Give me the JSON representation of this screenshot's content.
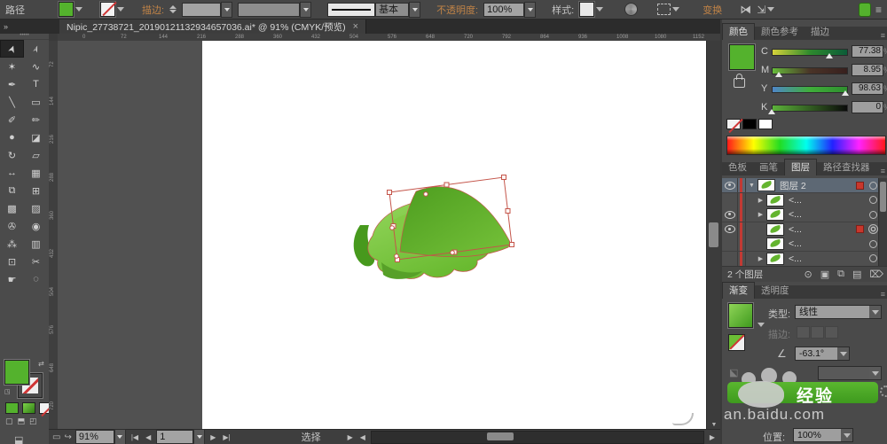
{
  "accent": {
    "green": "#54b22d",
    "selection_red": "#c4554a",
    "orange_label": "#c08347"
  },
  "control_bar": {
    "object_label": "路径",
    "stroke_label": "描边:",
    "stroke_width_value": "",
    "width_profile_value": "",
    "brush_definition_value": "基本",
    "opacity_label": "不透明度:",
    "opacity_value": "100%",
    "style_label": "样式:",
    "transform_label": "变换",
    "menu_icon": "≡"
  },
  "tab_bar": {
    "collapse_icon": "»",
    "title": "Nipic_27738721_20190121132934657036.ai* @ 91% (CMYK/预览)",
    "close_icon": "×"
  },
  "tools": [
    {
      "name": "selection-tool",
      "glyph": "➤",
      "active": true,
      "rot": true
    },
    {
      "name": "direct-selection-tool",
      "glyph": "➢",
      "active": false,
      "rot": true
    },
    {
      "name": "magic-wand-tool",
      "glyph": "✶"
    },
    {
      "name": "lasso-tool",
      "glyph": "∿"
    },
    {
      "name": "pen-tool",
      "glyph": "✒"
    },
    {
      "name": "type-tool",
      "glyph": "T"
    },
    {
      "name": "line-segment-tool",
      "glyph": "╲"
    },
    {
      "name": "rectangle-tool",
      "glyph": "▭"
    },
    {
      "name": "paintbrush-tool",
      "glyph": "✐"
    },
    {
      "name": "pencil-tool",
      "glyph": "✏"
    },
    {
      "name": "blob-brush-tool",
      "glyph": "●"
    },
    {
      "name": "eraser-tool",
      "glyph": "◪"
    },
    {
      "name": "rotate-tool",
      "glyph": "↻"
    },
    {
      "name": "scale-tool",
      "glyph": "▱"
    },
    {
      "name": "width-tool",
      "glyph": "↔"
    },
    {
      "name": "free-transform-tool",
      "glyph": "▦"
    },
    {
      "name": "shape-builder-tool",
      "glyph": "⧉"
    },
    {
      "name": "perspective-grid-tool",
      "glyph": "⊞"
    },
    {
      "name": "mesh-tool",
      "glyph": "▩"
    },
    {
      "name": "gradient-tool",
      "glyph": "▨"
    },
    {
      "name": "eyedropper-tool",
      "glyph": "✇"
    },
    {
      "name": "blend-tool",
      "glyph": "◉"
    },
    {
      "name": "symbol-sprayer-tool",
      "glyph": "⁂"
    },
    {
      "name": "column-graph-tool",
      "glyph": "▥"
    },
    {
      "name": "artboard-tool",
      "glyph": "⊡"
    },
    {
      "name": "slice-tool",
      "glyph": "✂"
    },
    {
      "name": "hand-tool",
      "glyph": "☛"
    },
    {
      "name": "zoom-tool",
      "glyph": "◌"
    }
  ],
  "rulers": {
    "h_labels": [
      "0",
      "72",
      "144",
      "216",
      "288",
      "360",
      "432",
      "504",
      "576",
      "648",
      "720",
      "792",
      "864",
      "936",
      "1008",
      "1080",
      "1152"
    ],
    "v_labels": [
      "72",
      "144",
      "216",
      "288",
      "360",
      "432",
      "504",
      "576",
      "648",
      "720"
    ]
  },
  "status_bar": {
    "zoom_value": "91%",
    "artboard_value": "1",
    "status_text": "选择",
    "nav_first": "|◀",
    "nav_prev": "◀",
    "nav_next": "▶",
    "nav_last": "▶|"
  },
  "color_panel": {
    "tabs": [
      {
        "label": "颜色",
        "active": true
      },
      {
        "label": "颜色参考",
        "active": false
      },
      {
        "label": "描边",
        "active": false
      }
    ],
    "menu_icon": "≡",
    "swatch_color": "#54b22d",
    "channels": [
      {
        "label": "C",
        "value": "77.38",
        "pct": 77,
        "track": "linear-gradient(90deg,#d6d23a,#2e8a2e,#0c5c38)"
      },
      {
        "label": "M",
        "value": "8.95",
        "pct": 9,
        "track": "linear-gradient(90deg,#66bb3a,#4a3428,#38201e)"
      },
      {
        "label": "Y",
        "value": "98.63",
        "pct": 99,
        "track": "linear-gradient(90deg,#4f86c8,#3fae3a,#2f8f2f)"
      },
      {
        "label": "K",
        "value": "0",
        "pct": 0,
        "track": "linear-gradient(90deg,#5cb23a,#0a0a0a)"
      }
    ],
    "pct_sign": "%"
  },
  "panel_tabs": [
    {
      "label": "色板",
      "active": false
    },
    {
      "label": "画笔",
      "active": false
    },
    {
      "label": "图层",
      "active": true
    },
    {
      "label": "路径查找器",
      "active": false
    }
  ],
  "layers": {
    "rows": [
      {
        "name": "图层 2",
        "eye": true,
        "expand": "▼",
        "selected": true,
        "indent": false,
        "target": "normal",
        "red_square": true
      },
      {
        "name": "<...",
        "eye": false,
        "expand": "▶",
        "selected": false,
        "indent": true,
        "target": "normal",
        "red_square": false
      },
      {
        "name": "<...",
        "eye": true,
        "expand": "▶",
        "selected": false,
        "indent": true,
        "target": "normal",
        "red_square": false
      },
      {
        "name": "<...",
        "eye": true,
        "expand": "",
        "selected": false,
        "indent": true,
        "target": "big",
        "red_square": true
      },
      {
        "name": "<...",
        "eye": false,
        "expand": "",
        "selected": false,
        "indent": true,
        "target": "normal",
        "red_square": false
      },
      {
        "name": "<...",
        "eye": false,
        "expand": "▶",
        "selected": false,
        "indent": true,
        "target": "normal",
        "red_square": false
      }
    ],
    "count_label": "2 个图层",
    "bottom_icons": [
      {
        "name": "locate-object-icon",
        "glyph": "⊙"
      },
      {
        "name": "make-clip-mask-icon",
        "glyph": "▣"
      },
      {
        "name": "new-sublayer-icon",
        "glyph": "⧉"
      },
      {
        "name": "new-layer-icon",
        "glyph": "▤"
      },
      {
        "name": "delete-layer-icon",
        "glyph": "⌦"
      }
    ]
  },
  "gradient_panel": {
    "tabs": [
      {
        "label": "渐变",
        "active": true
      },
      {
        "label": "透明度",
        "active": false
      }
    ],
    "menu_icon": "≡",
    "type_label": "类型:",
    "type_value": "线性",
    "stroke_label": "描边:",
    "angle_value": "-63.1°",
    "position_label": "位置:",
    "position_value": "100%"
  },
  "watermark": {
    "brand_text": "经验",
    "url_text": "an.baidu.com"
  }
}
